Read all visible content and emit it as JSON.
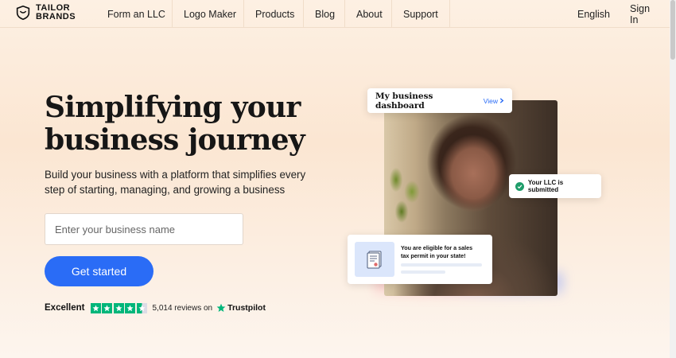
{
  "brand": {
    "name_line1": "TAILOR",
    "name_line2": "BRANDS"
  },
  "nav": {
    "items": [
      "Form an LLC",
      "Logo Maker",
      "Products",
      "Blog",
      "About",
      "Support"
    ],
    "language": "English",
    "signin": "Sign In"
  },
  "hero": {
    "headline": "Simplifying your business journey",
    "subcopy": "Build your business with a platform that simplifies every step of starting, managing, and growing a business",
    "input_placeholder": "Enter your business name",
    "cta": "Get started"
  },
  "rating": {
    "label": "Excellent",
    "stars": 4.5,
    "reviews": "5,014 reviews on",
    "provider": "Trustpilot",
    "star_color": "#00b67a"
  },
  "visual": {
    "dashboard_title": "My business dashboard",
    "view_link": "View",
    "llc_status": "Your LLC is submitted",
    "tax_message": "You are eligible for a sales tax permit in your state!"
  },
  "colors": {
    "accent": "#2a6cf6",
    "success": "#1f9d6a"
  }
}
